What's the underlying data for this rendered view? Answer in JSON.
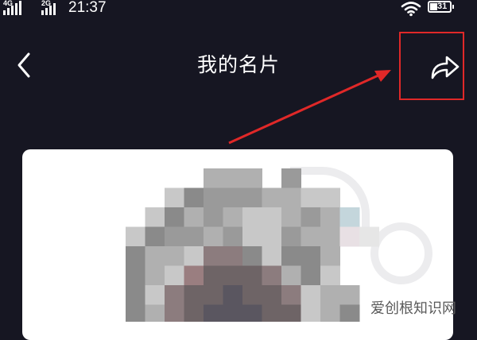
{
  "status_bar": {
    "network_left": "4G",
    "network_right": "2G",
    "time": "21:37",
    "battery_level": "31"
  },
  "header": {
    "title": "我的名片",
    "back_icon": "chevron-left-icon",
    "share_icon": "share-arrow-icon"
  },
  "annotation": {
    "color": "#e02828"
  },
  "card": {
    "avatar": "pixelated-avatar"
  },
  "watermark": {
    "text": "爱创根知识网"
  }
}
